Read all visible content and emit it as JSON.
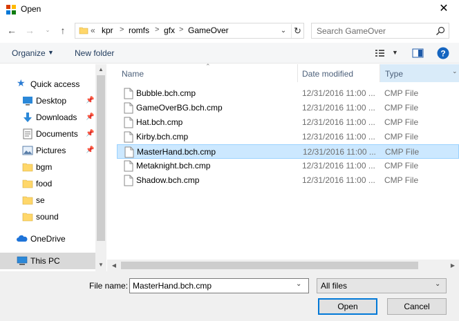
{
  "window": {
    "title": "Open"
  },
  "address": {
    "overflow": "«",
    "crumbs": [
      "kpr",
      "romfs",
      "gfx",
      "GameOver"
    ],
    "separator": ">"
  },
  "search": {
    "placeholder": "Search GameOver"
  },
  "toolbar": {
    "organize": "Organize",
    "new_folder": "New folder"
  },
  "nav": {
    "quick_access": "Quick access",
    "items": [
      {
        "label": "Desktop",
        "pinned": true,
        "icon": "desktop-icon"
      },
      {
        "label": "Downloads",
        "pinned": true,
        "icon": "download-icon"
      },
      {
        "label": "Documents",
        "pinned": true,
        "icon": "documents-icon"
      },
      {
        "label": "Pictures",
        "pinned": true,
        "icon": "pictures-icon"
      },
      {
        "label": "bgm",
        "pinned": false,
        "icon": "folder-icon"
      },
      {
        "label": "food",
        "pinned": false,
        "icon": "folder-icon"
      },
      {
        "label": "se",
        "pinned": false,
        "icon": "folder-icon"
      },
      {
        "label": "sound",
        "pinned": false,
        "icon": "folder-icon"
      }
    ],
    "onedrive": "OneDrive",
    "this_pc": "This PC"
  },
  "columns": {
    "name": "Name",
    "date": "Date modified",
    "type": "Type"
  },
  "files": [
    {
      "name": "Bubble.bch.cmp",
      "date": "12/31/2016 11:00 ...",
      "type": "CMP File"
    },
    {
      "name": "GameOverBG.bch.cmp",
      "date": "12/31/2016 11:00 ...",
      "type": "CMP File"
    },
    {
      "name": "Hat.bch.cmp",
      "date": "12/31/2016 11:00 ...",
      "type": "CMP File"
    },
    {
      "name": "Kirby.bch.cmp",
      "date": "12/31/2016 11:00 ...",
      "type": "CMP File"
    },
    {
      "name": "MasterHand.bch.cmp",
      "date": "12/31/2016 11:00 ...",
      "type": "CMP File"
    },
    {
      "name": "Metaknight.bch.cmp",
      "date": "12/31/2016 11:00 ...",
      "type": "CMP File"
    },
    {
      "name": "Shadow.bch.cmp",
      "date": "12/31/2016 11:00 ...",
      "type": "CMP File"
    }
  ],
  "selected_file": "MasterHand.bch.cmp",
  "bottom": {
    "file_name_label": "File name:",
    "file_name_value": "MasterHand.bch.cmp",
    "filter": "All files",
    "open": "Open",
    "cancel": "Cancel"
  },
  "colors": {
    "accent": "#0078d7",
    "selection": "#cce8ff",
    "folder": "#ffd76a"
  }
}
